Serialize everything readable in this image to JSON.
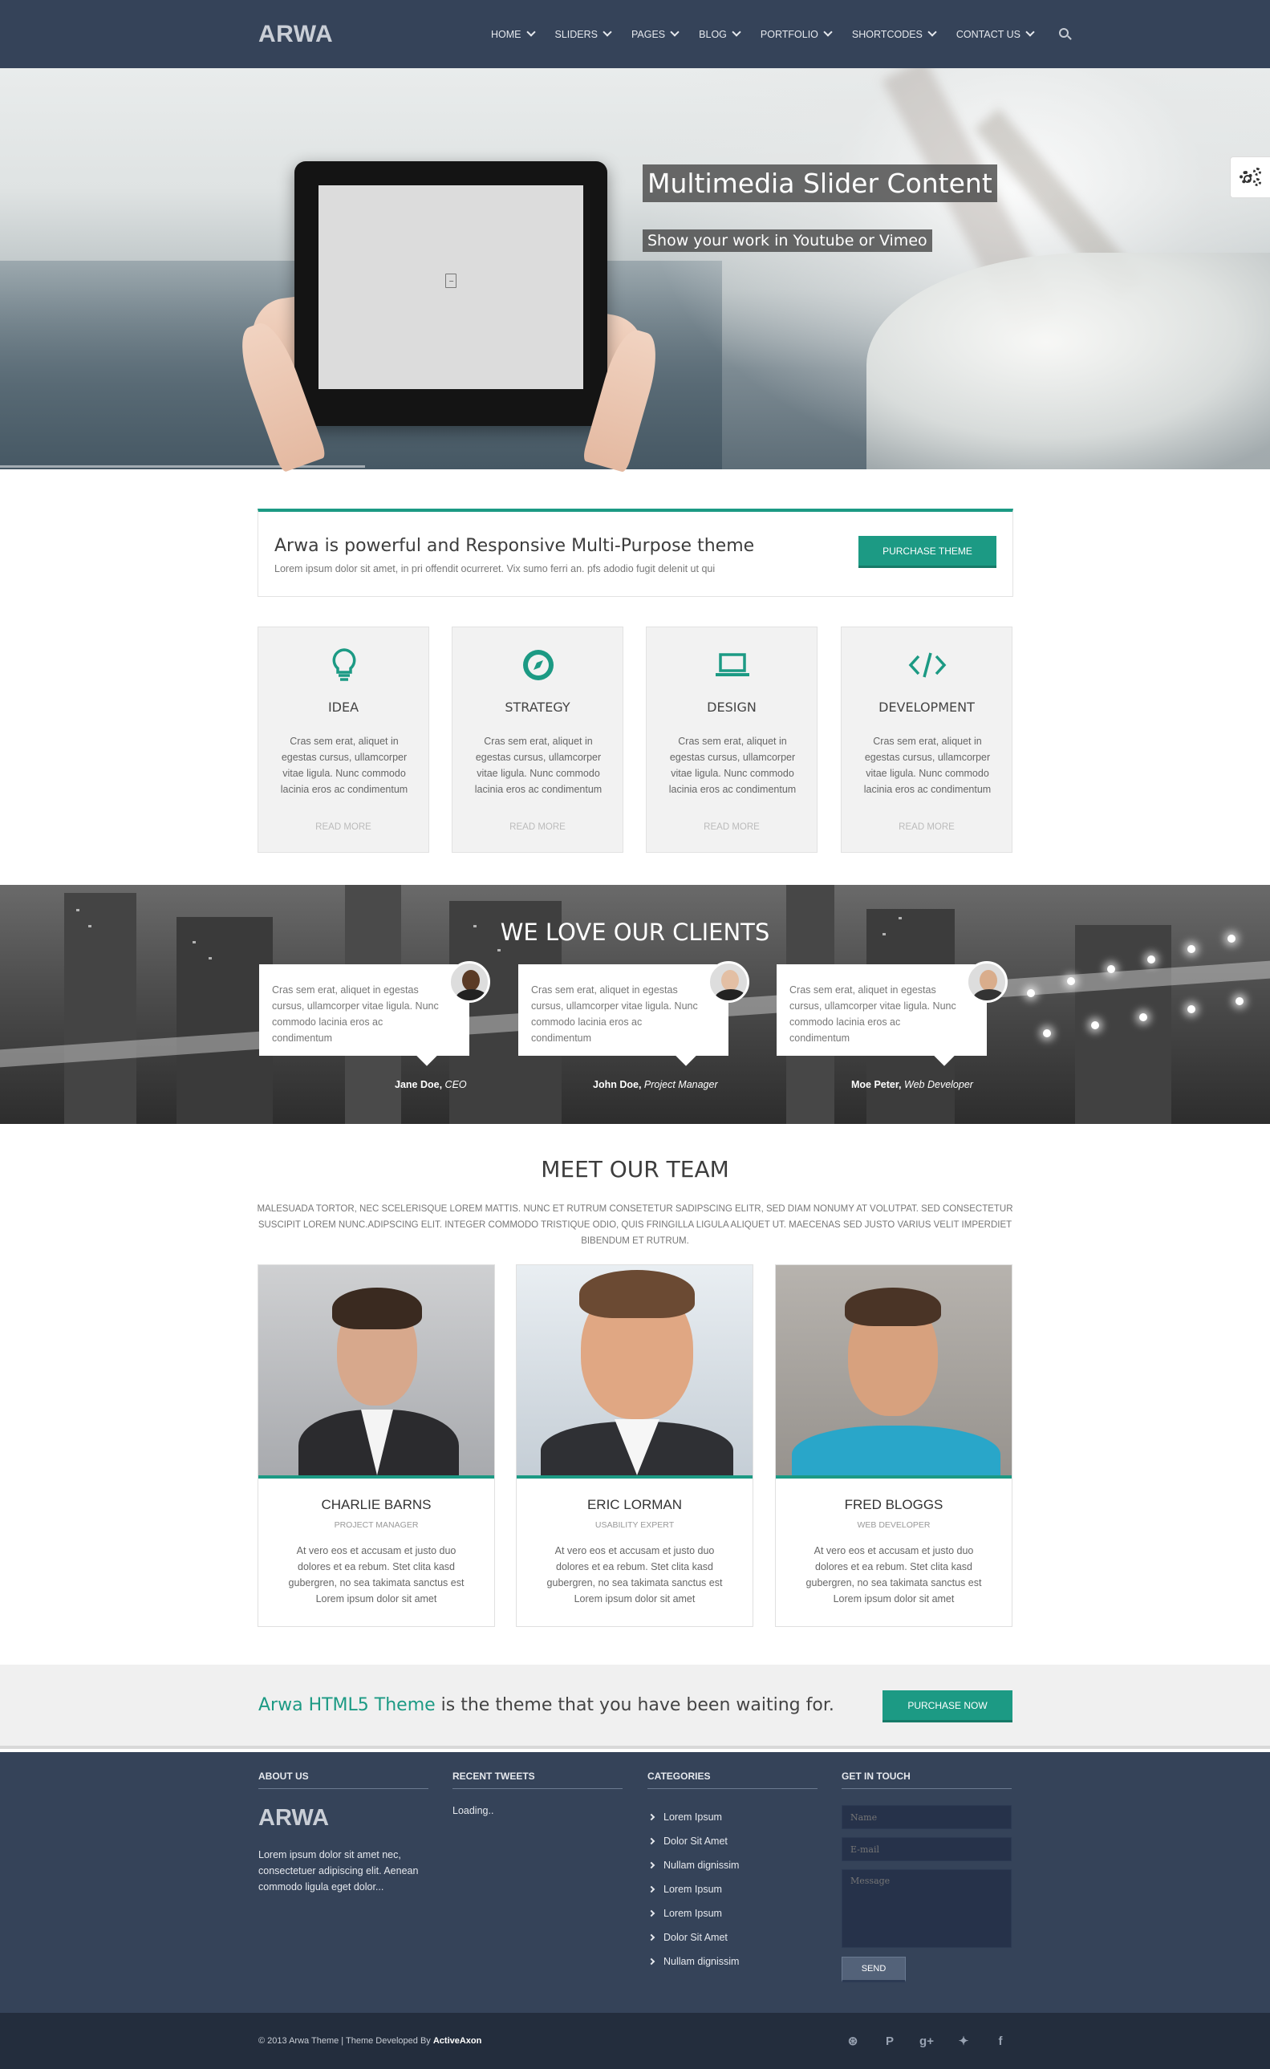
{
  "header": {
    "logo": "ARWA",
    "nav": [
      {
        "label": "HOME"
      },
      {
        "label": "SLIDERS"
      },
      {
        "label": "PAGES"
      },
      {
        "label": "BLOG"
      },
      {
        "label": "PORTFOLIO"
      },
      {
        "label": "SHORTCODES"
      },
      {
        "label": "CONTACT US"
      }
    ]
  },
  "hero": {
    "title": "Multimedia Slider Content",
    "subtitle": "Show your work in Youtube or Vimeo"
  },
  "promo": {
    "title": "Arwa is powerful and Responsive Multi-Purpose theme",
    "text": "Lorem ipsum dolor sit amet, in pri offendit ocurreret. Vix sumo ferri an. pfs adodio fugit delenit ut qui",
    "button": "PURCHASE THEME"
  },
  "services": [
    {
      "title": "IDEA",
      "desc": "Cras sem erat, aliquet in egestas cursus, ullamcorper vitae ligula. Nunc commodo lacinia eros ac condimentum",
      "more": "READ MORE",
      "icon": "lightbulb-icon"
    },
    {
      "title": "STRATEGY",
      "desc": "Cras sem erat, aliquet in egestas cursus, ullamcorper vitae ligula. Nunc commodo lacinia eros ac condimentum",
      "more": "READ MORE",
      "icon": "compass-icon"
    },
    {
      "title": "DESIGN",
      "desc": "Cras sem erat, aliquet in egestas cursus, ullamcorper vitae ligula. Nunc commodo lacinia eros ac condimentum",
      "more": "READ MORE",
      "icon": "laptop-icon"
    },
    {
      "title": "DEVELOPMENT",
      "desc": "Cras sem erat, aliquet in egestas cursus, ullamcorper vitae ligula. Nunc commodo lacinia eros ac condimentum",
      "more": "READ MORE",
      "icon": "code-icon"
    }
  ],
  "clients": {
    "title": "WE LOVE OUR CLIENTS",
    "items": [
      {
        "text": "Cras sem erat, aliquet in egestas cursus, ullamcorper vitae ligula. Nunc commodo lacinia eros ac condimentum",
        "name": "Jane Doe,",
        "role": "CEO"
      },
      {
        "text": "Cras sem erat, aliquet in egestas cursus, ullamcorper vitae ligula. Nunc commodo lacinia eros ac condimentum",
        "name": "John Doe,",
        "role": "Project Manager"
      },
      {
        "text": "Cras sem erat, aliquet in egestas cursus, ullamcorper vitae ligula. Nunc commodo lacinia eros ac condimentum",
        "name": "Moe Peter,",
        "role": "Web Developer"
      }
    ]
  },
  "team": {
    "title": "MEET OUR TEAM",
    "desc": "MALESUADA TORTOR, NEC SCELERISQUE LOREM MATTIS. NUNC ET RUTRUM CONSETETUR SADIPSCING ELITR, SED DIAM NONUMY AT VOLUTPAT. SED CONSECTETUR SUSCIPIT LOREM NUNC.ADIPSCING ELIT. INTEGER COMMODO TRISTIQUE ODIO, QUIS FRINGILLA LIGULA ALIQUET UT. MAECENAS SED JUSTO VARIUS VELIT IMPERDIET BIBENDUM ET RUTRUM.",
    "members": [
      {
        "name": "CHARLIE BARNS",
        "role": "PROJECT MANAGER",
        "bio": "At vero eos et accusam et justo duo dolores et ea rebum. Stet clita kasd gubergren, no sea takimata sanctus est Lorem ipsum dolor sit amet"
      },
      {
        "name": "ERIC LORMAN",
        "role": "USABILITY EXPERT",
        "bio": "At vero eos et accusam et justo duo dolores et ea rebum. Stet clita kasd gubergren, no sea takimata sanctus est Lorem ipsum dolor sit amet"
      },
      {
        "name": "FRED BLOGGS",
        "role": "WEB DEVELOPER",
        "bio": "At vero eos et accusam et justo duo dolores et ea rebum. Stet clita kasd gubergren, no sea takimata sanctus est Lorem ipsum dolor sit amet"
      }
    ]
  },
  "cta": {
    "accent": "Arwa HTML5 Theme",
    "text": " is the theme that you have been waiting for.",
    "button": "PURCHASE NOW"
  },
  "footer": {
    "about_title": "ABOUT US",
    "logo": "ARWA",
    "about_text": "Lorem ipsum dolor sit amet nec, consectetuer adipiscing elit. Aenean commodo ligula eget dolor...",
    "tweets_title": "RECENT TWEETS",
    "tweets_text": "Loading..",
    "categories_title": "CATEGORIES",
    "categories": [
      "Lorem Ipsum",
      "Dolor Sit Amet",
      "Nullam dignissim",
      "Lorem Ipsum",
      "Lorem Ipsum",
      "Dolor Sit Amet",
      "Nullam dignissim"
    ],
    "contact_title": "GET IN TOUCH",
    "name_placeholder": "Name",
    "email_placeholder": "E-mail",
    "message_placeholder": "Message",
    "send": "SEND"
  },
  "bottom": {
    "copyright": "© 2013 Arwa Theme | Theme Developed By ",
    "developer": "ActiveAxon",
    "socials": [
      {
        "icon": "dribbble-icon",
        "glyph": "⊛"
      },
      {
        "icon": "pinterest-icon",
        "glyph": "P"
      },
      {
        "icon": "google-plus-icon",
        "glyph": "g+"
      },
      {
        "icon": "twitter-icon",
        "glyph": "✦"
      },
      {
        "icon": "facebook-icon",
        "glyph": "f"
      }
    ]
  },
  "colors": {
    "accent": "#1c9a84",
    "header": "#354359",
    "footer_bottom": "#232d3d"
  }
}
